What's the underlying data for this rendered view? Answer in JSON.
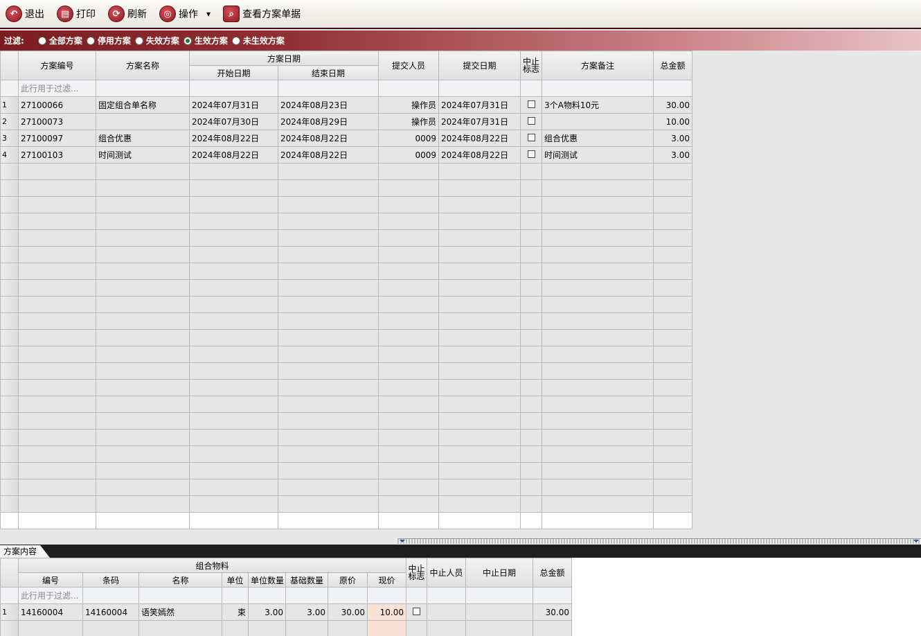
{
  "toolbar": {
    "exit": "退出",
    "print": "打印",
    "refresh": "刷新",
    "operate": "操作",
    "view_doc": "查看方案单据"
  },
  "filter": {
    "label": "过滤:",
    "options": [
      "全部方案",
      "停用方案",
      "失效方案",
      "生效方案",
      "未生效方案"
    ],
    "selected": "生效方案"
  },
  "main_grid": {
    "headers": {
      "code": "方案编号",
      "name": "方案名称",
      "date_group": "方案日期",
      "start": "开始日期",
      "end": "结束日期",
      "submitter": "提交人员",
      "submit_date": "提交日期",
      "stop_flag": "中止\n标志",
      "remark": "方案备注",
      "total": "总金额"
    },
    "filter_placeholder": "此行用于过滤...",
    "rows": [
      {
        "no": "1",
        "code": "27100066",
        "name": "固定组合单名称",
        "start": "2024年07月31日",
        "end": "2024年08月23日",
        "submitter": "操作员",
        "submit_date": "2024年07月31日",
        "remark": "3个A物料10元",
        "total": "30.00"
      },
      {
        "no": "2",
        "code": "27100073",
        "name": "",
        "start": "2024年07月30日",
        "end": "2024年08月29日",
        "submitter": "操作员",
        "submit_date": "2024年07月31日",
        "remark": "",
        "total": "10.00"
      },
      {
        "no": "3",
        "code": "27100097",
        "name": "组合优惠",
        "start": "2024年08月22日",
        "end": "2024年08月22日",
        "submitter": "0009",
        "submit_date": "2024年08月22日",
        "remark": "组合优惠",
        "total": "3.00"
      },
      {
        "no": "4",
        "code": "27100103",
        "name": "时间测试",
        "start": "2024年08月22日",
        "end": "2024年08月22日",
        "submitter": "0009",
        "submit_date": "2024年08月22日",
        "remark": "时间测试",
        "total": "3.00"
      }
    ]
  },
  "detail_tab": "方案内容",
  "detail_grid": {
    "headers": {
      "group": "组合物料",
      "code": "编号",
      "barcode": "条码",
      "name": "名称",
      "unit": "单位",
      "unit_qty": "单位数量",
      "base_qty": "基础数量",
      "orig_price": "原价",
      "cur_price": "现价",
      "stop_flag": "中止\n标志",
      "stop_person": "中止人员",
      "stop_date": "中止日期",
      "total": "总金额"
    },
    "filter_placeholder": "此行用于过滤...",
    "rows": [
      {
        "no": "1",
        "code": "14160004",
        "barcode": "14160004",
        "name": "语笑嫣然",
        "unit": "束",
        "unit_qty": "3.00",
        "base_qty": "3.00",
        "orig_price": "30.00",
        "cur_price": "10.00",
        "stop_person": "",
        "stop_date": "",
        "total": "30.00"
      }
    ]
  }
}
